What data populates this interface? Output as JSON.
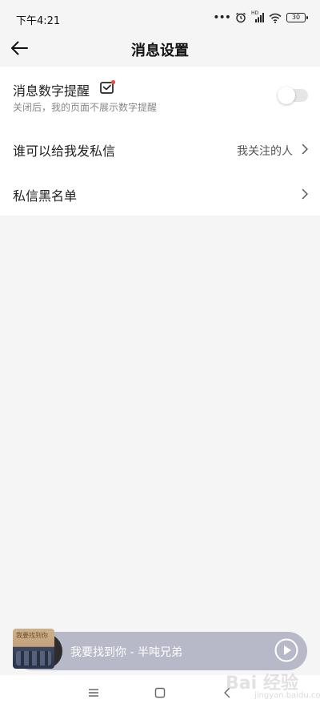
{
  "status_bar": {
    "time": "下午4:21",
    "network_badge": "HD",
    "battery": "30"
  },
  "header": {
    "title": "消息设置"
  },
  "settings": {
    "message_count_reminder": {
      "label": "消息数字提醒",
      "subtitle": "关闭后，我的页面不展示数字提醒",
      "enabled": false,
      "badge_icon": "mail-check-icon"
    },
    "who_can_dm": {
      "label": "谁可以给我发私信",
      "value": "我关注的人"
    },
    "dm_blacklist": {
      "label": "私信黑名单"
    }
  },
  "mini_player": {
    "song": "我要找到你 - 半吨兄弟",
    "cover_text": "我要找到你"
  },
  "watermark": {
    "text": "Bai 经验",
    "sub": "jingyan.baidu.com"
  },
  "colors": {
    "page_bg": "#f5f5f5",
    "card_bg": "#ffffff",
    "player_bg": "#b7b9c9",
    "notification_dot": "#e94b4b"
  }
}
